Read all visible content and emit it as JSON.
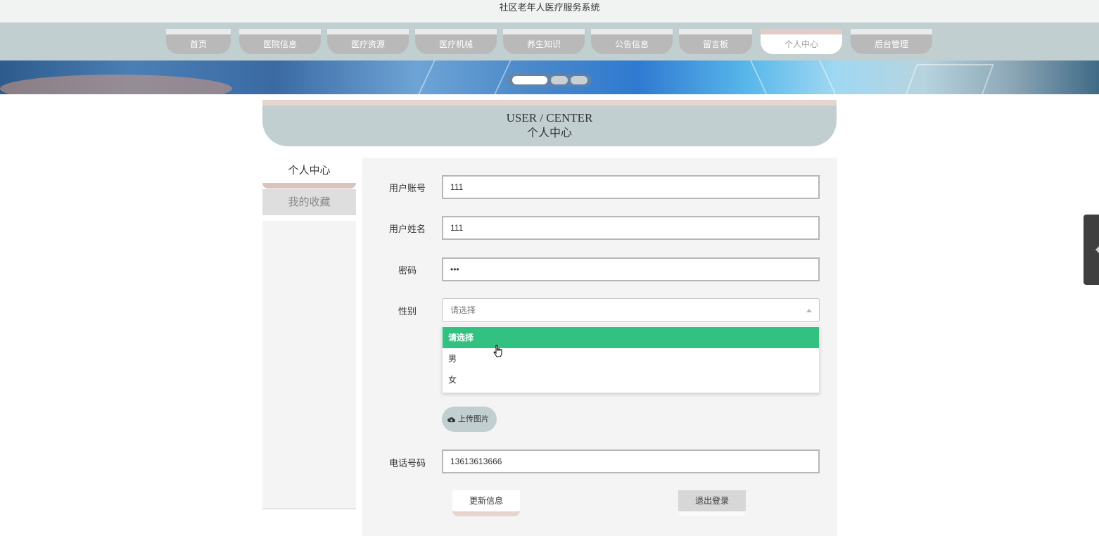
{
  "app_title": "社区老年人医疗服务系统",
  "nav": {
    "items": [
      {
        "label": "首页"
      },
      {
        "label": "医院信息"
      },
      {
        "label": "医疗资源"
      },
      {
        "label": "医疗机械"
      },
      {
        "label": "养生知识"
      },
      {
        "label": "公告信息"
      },
      {
        "label": "留言板"
      },
      {
        "label": "个人中心",
        "active": true
      },
      {
        "label": "后台管理"
      }
    ]
  },
  "banner": {
    "active_dot": 1,
    "dot_count": 3
  },
  "section": {
    "title_en": "USER / CENTER",
    "title_cn": "个人中心"
  },
  "sidebar": {
    "items": [
      {
        "label": "个人中心",
        "active": true
      },
      {
        "label": "我的收藏"
      }
    ]
  },
  "form": {
    "account_label": "用户账号",
    "account_value": "111",
    "name_label": "用户姓名",
    "name_value": "111",
    "password_label": "密码",
    "password_value": "•••",
    "gender_label": "性别",
    "gender_placeholder": "请选择",
    "gender_options": [
      "请选择",
      "男",
      "女"
    ],
    "gender_selected": "请选择",
    "upload_label": "上传图片",
    "phone_label": "电话号码",
    "phone_value": "13613613666",
    "update_button": "更新信息",
    "logout_button": "退出登录"
  },
  "colors": {
    "nav_bg": "#c1cfd1",
    "accent_green": "#32c181",
    "accent_pink": "#e6d5cf"
  }
}
